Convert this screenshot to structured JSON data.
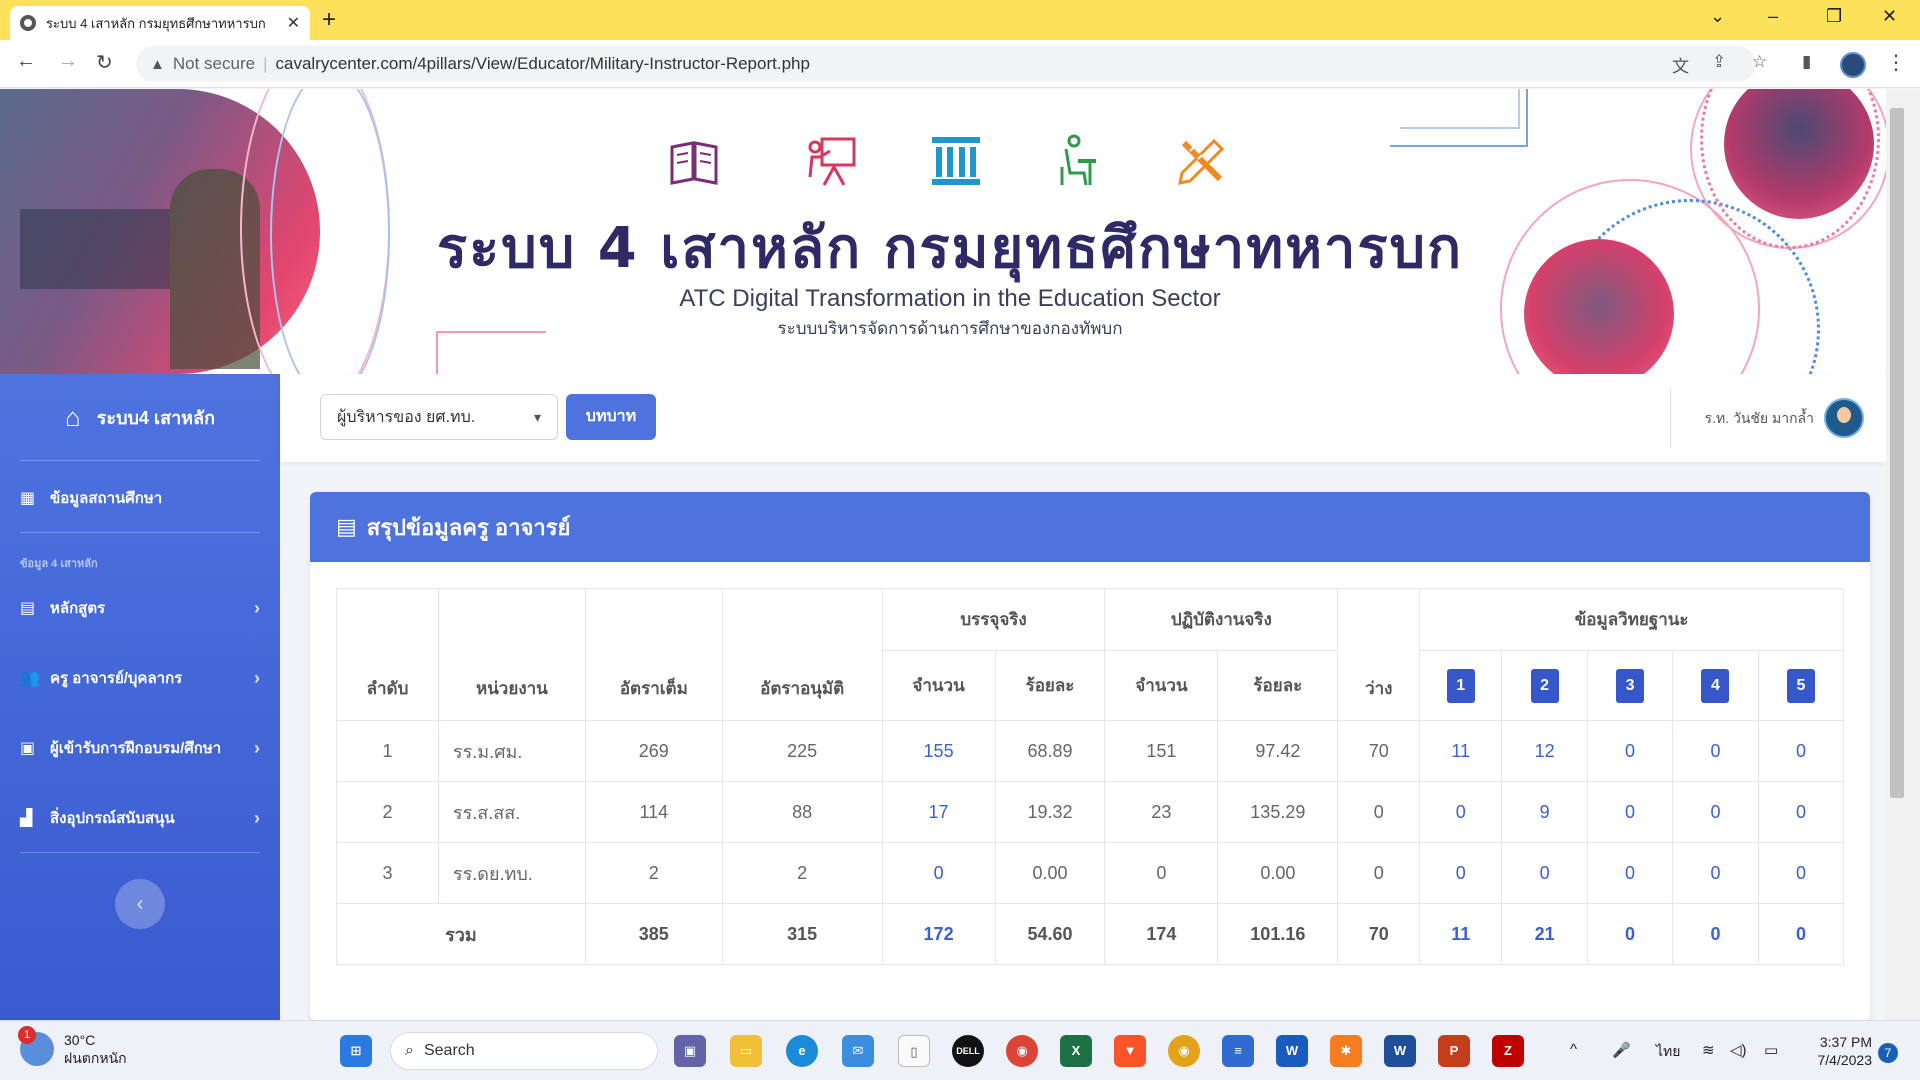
{
  "browser": {
    "tab_title": "ระบบ 4 เสาหลัก กรมยุทธศึกษาทหารบก",
    "not_secure": "Not secure",
    "url": "cavalrycenter.com/4pillars/View/Educator/Military-Instructor-Report.php"
  },
  "banner": {
    "title": "ระบบ 4 เสาหลัก กรมยุทธศึกษาทหารบก",
    "subtitle": "ATC Digital Transformation in the Education Sector",
    "subtitle_th": "ระบบบริหารจัดการด้านการศึกษาของกองทัพบก"
  },
  "sidebar": {
    "brand": "ระบบ4 เสาหลัก",
    "school_info": "ข้อมูลสถานศึกษา",
    "heading": "ข้อมูล 4 เสาหลัก",
    "items": [
      {
        "label": "หลักสูตร"
      },
      {
        "label": "ครู อาจารย์/บุคลากร"
      },
      {
        "label": "ผู้เข้ารับการฝึกอบรม/ศึกษา"
      },
      {
        "label": "สิ่งอุปกรณ์สนับสนุน"
      }
    ]
  },
  "topbar": {
    "role_value": "ผู้บริหารของ ยศ.ทบ.",
    "role_button": "บทบาท",
    "user_name": "ร.ท. วันชัย มากล้ำ"
  },
  "card": {
    "title": "สรุปข้อมูลครู อาจารย์"
  },
  "table": {
    "headers": {
      "no": "ลำดับ",
      "unit": "หน่วยงาน",
      "full_rate": "อัตราเต็ม",
      "approved_rate": "อัตราอนุมัติ",
      "filled": "บรรจุจริง",
      "working": "ปฏิบัติงานจริง",
      "count": "จำนวน",
      "percent": "ร้อยละ",
      "vacant": "ว่าง",
      "qualification": "ข้อมูลวิทยฐานะ",
      "levels": [
        "1",
        "2",
        "3",
        "4",
        "5"
      ]
    },
    "rows": [
      {
        "no": "1",
        "unit": "รร.ม.ศม.",
        "full": "269",
        "approved": "225",
        "filled": "155",
        "filled_pct": "68.89",
        "working": "151",
        "working_pct": "97.42",
        "vacant": "70",
        "l1": "11",
        "l2": "12",
        "l3": "0",
        "l4": "0",
        "l5": "0"
      },
      {
        "no": "2",
        "unit": "รร.ส.สส.",
        "full": "114",
        "approved": "88",
        "filled": "17",
        "filled_pct": "19.32",
        "working": "23",
        "working_pct": "135.29",
        "vacant": "0",
        "l1": "0",
        "l2": "9",
        "l3": "0",
        "l4": "0",
        "l5": "0"
      },
      {
        "no": "3",
        "unit": "รร.ดย.ทบ.",
        "full": "2",
        "approved": "2",
        "filled": "0",
        "filled_pct": "0.00",
        "working": "0",
        "working_pct": "0.00",
        "vacant": "0",
        "l1": "0",
        "l2": "0",
        "l3": "0",
        "l4": "0",
        "l5": "0"
      }
    ],
    "total": {
      "label": "รวม",
      "full": "385",
      "approved": "315",
      "filled": "172",
      "filled_pct": "54.60",
      "working": "174",
      "working_pct": "101.16",
      "vacant": "70",
      "l1": "11",
      "l2": "21",
      "l3": "0",
      "l4": "0",
      "l5": "0"
    }
  },
  "taskbar": {
    "weather_badge": "1",
    "temp": "30°C",
    "weather": "ฝนตกหนัก",
    "search": "Search",
    "lang": "ไทย",
    "time": "3:37 PM",
    "date": "7/4/2023",
    "notif": "7"
  },
  "colors": {
    "accent": "#4e73df",
    "tab_bar": "#fde15a",
    "link": "#3b5fd6"
  }
}
